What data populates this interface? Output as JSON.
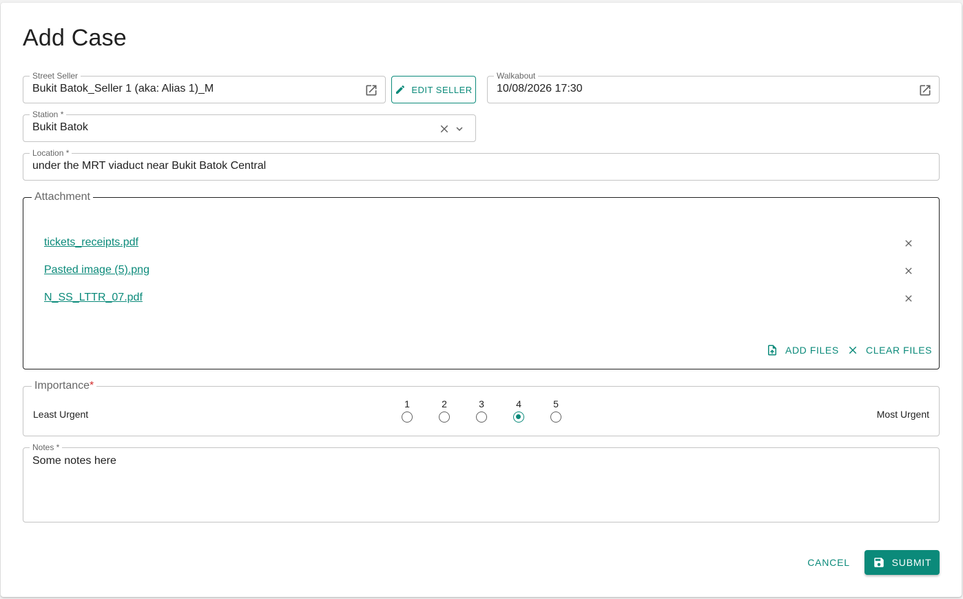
{
  "dialog": {
    "title": "Add Case"
  },
  "street_seller": {
    "label": "Street Seller",
    "value": "Bukit Batok_Seller 1 (aka: Alias 1)_M",
    "open_icon": "open-in-new-icon"
  },
  "edit_seller": {
    "label": "EDIT SELLER",
    "icon": "pencil-icon"
  },
  "walkabout": {
    "label": "Walkabout",
    "value": "10/08/2026 17:30",
    "open_icon": "open-in-new-icon"
  },
  "station": {
    "label": "Station *",
    "value": "Bukit Batok",
    "clear_icon": "close-icon",
    "dropdown_icon": "chevron-down-icon"
  },
  "location": {
    "label": "Location *",
    "value": "under the MRT viaduct near Bukit Batok Central"
  },
  "attachment": {
    "legend": "Attachment",
    "files": [
      {
        "name": "tickets_receipts.pdf"
      },
      {
        "name": "Pasted image (5).png"
      },
      {
        "name": "N_SS_LTTR_07.pdf"
      }
    ],
    "add_files_label": "ADD FILES",
    "clear_files_label": "CLEAR FILES"
  },
  "importance": {
    "legend": "Importance",
    "required_mark": "*",
    "min_label": "Least Urgent",
    "max_label": "Most Urgent",
    "options": [
      "1",
      "2",
      "3",
      "4",
      "5"
    ],
    "selected": "4"
  },
  "notes": {
    "label": "Notes *",
    "value": "Some notes here"
  },
  "actions": {
    "cancel_label": "CANCEL",
    "submit_label": "SUBMIT",
    "submit_icon": "save-icon"
  },
  "colors": {
    "accent": "#0b8a7a",
    "required": "#d32f2f",
    "border": "#c4c4c4"
  }
}
